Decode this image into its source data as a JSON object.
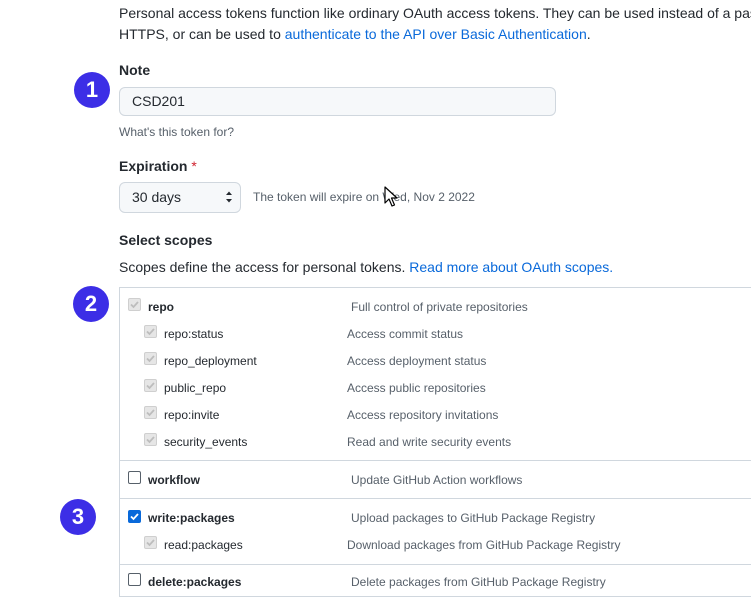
{
  "intro": {
    "line1": "Personal access tokens function like ordinary OAuth access tokens. They can be used instead of a passw",
    "line2_prefix": "HTTPS, or can be used to ",
    "line2_link": "authenticate to the API over Basic Authentication",
    "line2_suffix": "."
  },
  "steps": [
    "1",
    "2",
    "3"
  ],
  "note": {
    "label": "Note",
    "value": "CSD201",
    "hint": "What's this token for?"
  },
  "expiration": {
    "label": "Expiration",
    "required_mark": "*",
    "selected": "30 days",
    "message": "The token will expire on Wed, Nov 2 2022"
  },
  "scopes": {
    "title": "Select scopes",
    "description": "Scopes define the access for personal tokens. ",
    "link": "Read more about OAuth scopes.",
    "items": [
      {
        "name": "repo",
        "desc": "Full control of private repositories",
        "state": "disabled"
      },
      {
        "name": "repo:status",
        "desc": "Access commit status",
        "state": "disabled"
      },
      {
        "name": "repo_deployment",
        "desc": "Access deployment status",
        "state": "disabled"
      },
      {
        "name": "public_repo",
        "desc": "Access public repositories",
        "state": "disabled"
      },
      {
        "name": "repo:invite",
        "desc": "Access repository invitations",
        "state": "disabled"
      },
      {
        "name": "security_events",
        "desc": "Read and write security events",
        "state": "disabled"
      },
      {
        "name": "workflow",
        "desc": "Update GitHub Action workflows",
        "state": "unchecked"
      },
      {
        "name": "write:packages",
        "desc": "Upload packages to GitHub Package Registry",
        "state": "checked"
      },
      {
        "name": "read:packages",
        "desc": "Download packages from GitHub Package Registry",
        "state": "disabled"
      },
      {
        "name": "delete:packages",
        "desc": "Delete packages from GitHub Package Registry",
        "state": "unchecked"
      }
    ]
  },
  "colors": {
    "accent": "#0969da",
    "step_badge": "#3c2ee6",
    "required": "#cf222e"
  }
}
